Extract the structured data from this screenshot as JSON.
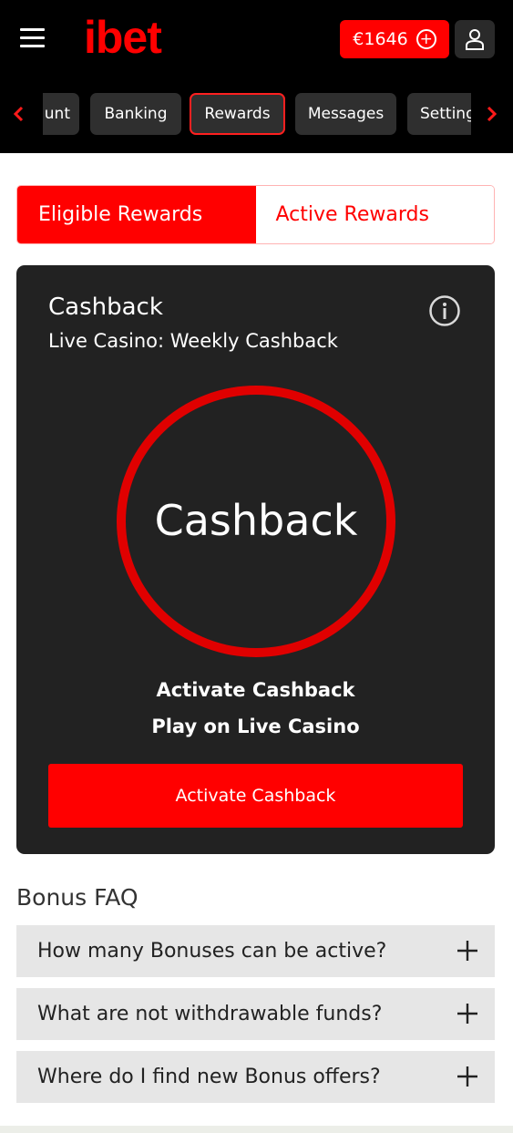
{
  "header": {
    "logo": "ibet",
    "balance": "€1646",
    "colors": {
      "brand": "#ff0000",
      "background": "#000000"
    }
  },
  "nav_tabs": [
    {
      "label": "unt"
    },
    {
      "label": "Banking"
    },
    {
      "label": "Rewards",
      "active": true
    },
    {
      "label": "Messages"
    },
    {
      "label": "Settings"
    }
  ],
  "segments": {
    "eligible": "Eligible Rewards",
    "active": "Active Rewards",
    "selected": "Eligible Rewards"
  },
  "card": {
    "title": "Cashback",
    "subtitle": "Live Casino: Weekly Cashback",
    "ring_label": "Cashback",
    "line1": "Activate Cashback",
    "line2": "Play on Live Casino",
    "button": "Activate Cashback"
  },
  "faq": {
    "title": "Bonus FAQ",
    "items": [
      {
        "question": "How many Bonuses can be active?"
      },
      {
        "question": "What are not withdrawable funds?"
      },
      {
        "question": "Where do I find new Bonus offers?"
      }
    ]
  }
}
